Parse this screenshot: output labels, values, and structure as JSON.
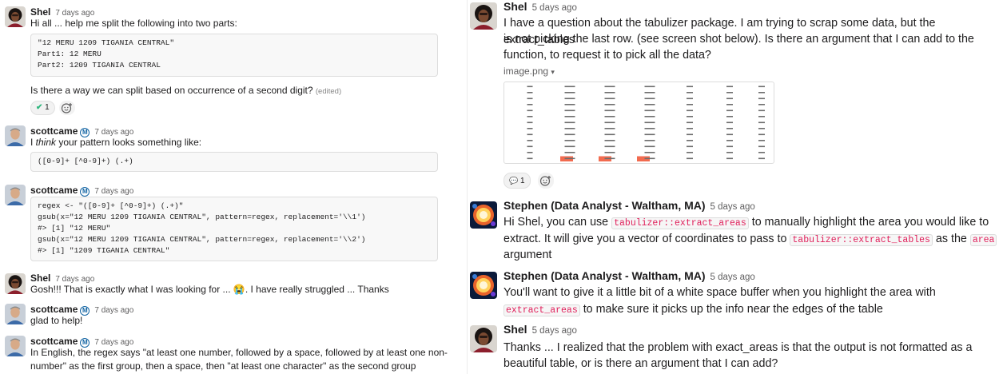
{
  "left": {
    "messages": [
      {
        "author": "Shel",
        "time": "7 days ago",
        "text": "Hi all ... help me split the following into two parts:",
        "code": [
          "\"12 MERU 1209 TIGANIA CENTRAL\"",
          "Part1: 12 MERU",
          "Part2: 1209 TIGANIA CENTRAL"
        ],
        "text2": "Is there a way we can split based on occurrence of a second digit?",
        "edited": "(edited)",
        "reactions": [
          {
            "emoji": "✔",
            "count": "1"
          }
        ]
      },
      {
        "author": "scottcame",
        "badge": "M",
        "time": "7 days ago",
        "text_pre": "I ",
        "text_em": "think",
        "text_post": " your pattern looks something like:",
        "code": [
          "([0-9]+ [^0-9]+) (.+)"
        ]
      },
      {
        "author": "scottcame",
        "badge": "M",
        "time": "7 days ago",
        "code": [
          "regex <- \"([0-9]+ [^0-9]+) (.+)\"",
          "gsub(x=\"12 MERU 1209 TIGANIA CENTRAL\", pattern=regex, replacement='\\\\1')",
          "#> [1] \"12 MERU\"",
          "gsub(x=\"12 MERU 1209 TIGANIA CENTRAL\", pattern=regex, replacement='\\\\2')",
          "#> [1] \"1209 TIGANIA CENTRAL\""
        ]
      },
      {
        "author": "Shel",
        "time": "7 days ago",
        "text_pre": "Gosh!!! That is exactly what I was looking for ... ",
        "emoji": "😭",
        "text_post": ". I have really struggled ... Thanks"
      },
      {
        "author": "scottcame",
        "badge": "M",
        "time": "7 days ago",
        "text": "glad to help!"
      },
      {
        "author": "scottcame",
        "badge": "M",
        "time": "7 days ago",
        "text": "In English, the regex says \"at least one number, followed by a space, followed by at least one non-",
        "text2": "number\" as the first group, then a space, then \"at least one character\" as the second group"
      }
    ]
  },
  "right": {
    "messages": [
      {
        "author": "Shel",
        "time": "5 days ago",
        "lines": [
          "I have a question about the tabulizer package. I am trying to scrap some data, but the extract_tables",
          "is not picking the last row. (see screen shot below). Is there an argument that I can add to the",
          "function, to request it to pick all the data?"
        ],
        "file_name": "image.png",
        "file_chevron": "▾",
        "reactions": [
          {
            "emoji": "💬",
            "count": "1"
          }
        ]
      },
      {
        "author": "Stephen (Data Analyst - Waltham, MA)",
        "time": "5 days ago",
        "l1_pre": "Hi Shel, you can use ",
        "l1_code": "tabulizer::extract_areas",
        "l1_post": " to manually highlight the area you would like to",
        "l2_pre": "extract. It will give you a vector of coordinates to pass to ",
        "l2_code": "tabulizer::extract_tables",
        "l2_mid": " as the ",
        "l2_code2": "area",
        "l3": "argument"
      },
      {
        "author": "Stephen (Data Analyst - Waltham, MA)",
        "time": "5 days ago",
        "l1": "You'll want to give it a little bit of a white space buffer when you highlight the area with",
        "l2_code": "extract_areas",
        "l2_post": " to make sure it picks up the info near the edges of the table"
      },
      {
        "author": "Shel",
        "time": "5 days ago",
        "lines": [
          "Thanks ... I realized that the problem with exact_areas is that the output is not formatted as a",
          "beautiful table, or is there an argument that I can add?"
        ]
      }
    ]
  },
  "colors": {
    "accent": "#1264a3",
    "code_inline": "#e01e5a",
    "reaction_bg": "#f2f2f2",
    "highlight_row": "#f26b4f"
  }
}
